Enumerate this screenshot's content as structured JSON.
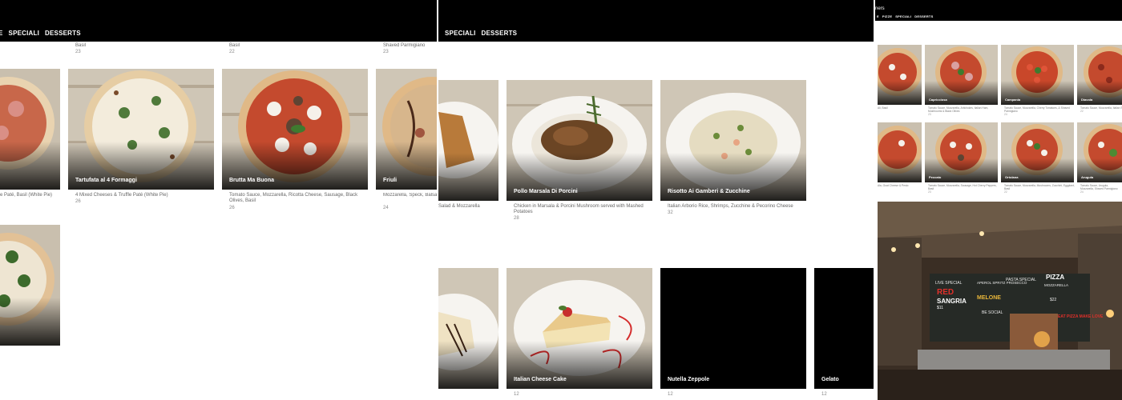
{
  "nav": {
    "partial": "E",
    "speciali": "SPECIALI",
    "desserts": "DESSERTS",
    "pizze": "PIZZE",
    "p3_title": "ners"
  },
  "p1": {
    "top_row": [
      {
        "desc": "Basil",
        "price": "23"
      },
      {
        "desc": "Basil",
        "price": "22"
      },
      {
        "desc": "Shaved Parmigiano",
        "price": "23"
      }
    ],
    "cards": [
      {
        "title": "",
        "desc": "e Paté, Basil (White Pie)",
        "price": ""
      },
      {
        "title": "Tartufata al 4 Formaggi",
        "desc": "4 Mixed Cheeses & Truffle Paté (White Pie)",
        "price": "26"
      },
      {
        "title": "Brutta Ma Buona",
        "desc": "Tomato Sauce, Mozzarella, Ricotta Cheese, Sausage, Black Olives, Basil",
        "price": "26"
      },
      {
        "title": "Friuli",
        "desc": "Mozzarella, Speck, Balsa Mushrooms",
        "price": "24"
      }
    ]
  },
  "p2": {
    "cards": [
      {
        "title": "",
        "desc": "Salad & Mozzarella",
        "price": ""
      },
      {
        "title": "Pollo Marsala Di Porcini",
        "desc": "Chicken in Marsala & Porcini Mushroom served with Mashed Potatoes",
        "price": "28"
      },
      {
        "title": "Risotto Ai Gamberi & Zucchine",
        "desc": "Italian Arborio Rice, Shrimps, Zucchine & Pecorino Cheese",
        "price": "32"
      },
      {
        "title": "",
        "desc": "",
        "price": ""
      },
      {
        "title": "Italian Cheese Cake",
        "desc": "",
        "price": "12"
      },
      {
        "title": "Nutella Zeppole",
        "desc": "",
        "price": "12"
      },
      {
        "title": "Gelato",
        "desc": "",
        "price": "12"
      }
    ]
  },
  "p3": {
    "row1": [
      {
        "title": "",
        "desc": "Ali, Basil",
        "price": ""
      },
      {
        "title": "Capricciosa",
        "desc": "Tomato Sauce, Mozzarella, Artichokes, Italian Ham, Mushrooms & Black Olives",
        "price": "23"
      },
      {
        "title": "Campania",
        "desc": "Tomato Sauce, Mozzarella, Cherry Tomatoes, & Shaved Parmigiano",
        "price": "24"
      },
      {
        "title": "Diavola",
        "desc": "Tomato Sauce, Mozzarella, Italian Sal",
        "price": "22"
      }
    ],
    "row2": [
      {
        "title": "",
        "desc": "Ala, Goat Cheese & Pesto",
        "price": ""
      },
      {
        "title": "Peccato",
        "desc": "Tomato Sauce, Mozzarella, Sausage, Hot Cherry Peppers, Basil",
        "price": "23"
      },
      {
        "title": "Ortolana",
        "desc": "Tomato Sauce, Mozzarella, Mushrooms, Zucchini, Eggplant, Basil",
        "price": "22"
      },
      {
        "title": "Arugula",
        "desc": "Tomato Sauce, Arugula, Mozzarella, Shaved Parmigiano",
        "price": "24"
      }
    ],
    "chalkboard": {
      "specials": "LIVE SPECIAL",
      "red": "RED",
      "sangria": "SANGRIA",
      "price1": "$11",
      "prosecco": "APEROL SPRITZ PROSECCO",
      "melone": "MELONE",
      "pasta": "PASTA SPECIAL",
      "pizza": "PIZZA",
      "mozzarella": "MOZZARELLA",
      "price2": "$22",
      "eat": "EAT PIZZA MAKE LOVE",
      "social": "BE SOCIAL"
    }
  },
  "colors": {
    "nav_bg": "#000000",
    "title": "#ffffff",
    "desc": "#666666"
  }
}
